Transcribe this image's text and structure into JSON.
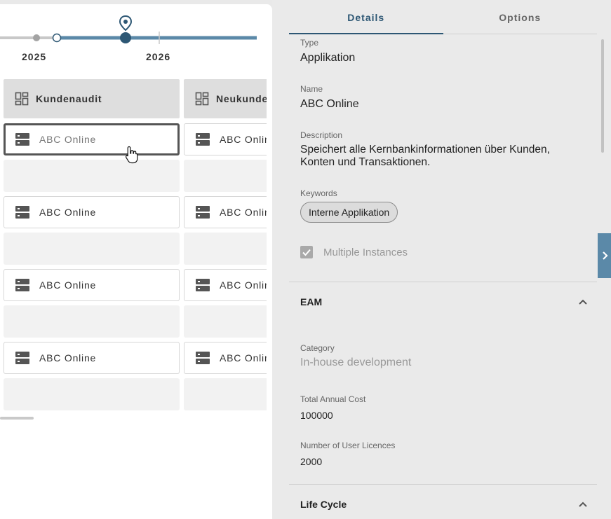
{
  "timeline": {
    "year_left": "2025",
    "year_right": "2026"
  },
  "board": {
    "columns": [
      {
        "title": "Kundenaudit",
        "rows": [
          {
            "kind": "card",
            "label": "ABC Online",
            "selected": true
          },
          {
            "kind": "empty"
          },
          {
            "kind": "card",
            "label": "ABC Online"
          },
          {
            "kind": "empty"
          },
          {
            "kind": "card",
            "label": "ABC Online"
          },
          {
            "kind": "empty"
          },
          {
            "kind": "card",
            "label": "ABC Online"
          },
          {
            "kind": "empty"
          }
        ]
      },
      {
        "title": "Neukunde",
        "rows": [
          {
            "kind": "card",
            "label": "ABC Onlin"
          },
          {
            "kind": "empty"
          },
          {
            "kind": "card",
            "label": "ABC Onlin"
          },
          {
            "kind": "empty"
          },
          {
            "kind": "card",
            "label": "ABC Onlin"
          },
          {
            "kind": "empty"
          },
          {
            "kind": "card",
            "label": "ABC Onlin"
          },
          {
            "kind": "empty"
          }
        ]
      }
    ]
  },
  "tabs": {
    "details": "Details",
    "options": "Options"
  },
  "details": {
    "type_label": "Type",
    "type_value": "Applikation",
    "name_label": "Name",
    "name_value": "ABC Online",
    "description_label": "Description",
    "description_value": "Speichert alle Kernbankinformationen über Kunden, Konten und Transaktionen.",
    "keywords_label": "Keywords",
    "keyword_chip": "Interne Applikation",
    "multiple_instances_label": "Multiple Instances",
    "multiple_instances_checked": true
  },
  "eam": {
    "title": "EAM",
    "category_label": "Category",
    "category_value": "In-house development",
    "total_cost_label": "Total Annual Cost",
    "total_cost_value": "100000",
    "licences_label": "Number of User Licences",
    "licences_value": "2000"
  },
  "lifecycle": {
    "title": "Life Cycle"
  },
  "colors": {
    "accent": "#2d5774",
    "toggle": "#5b89a8"
  }
}
